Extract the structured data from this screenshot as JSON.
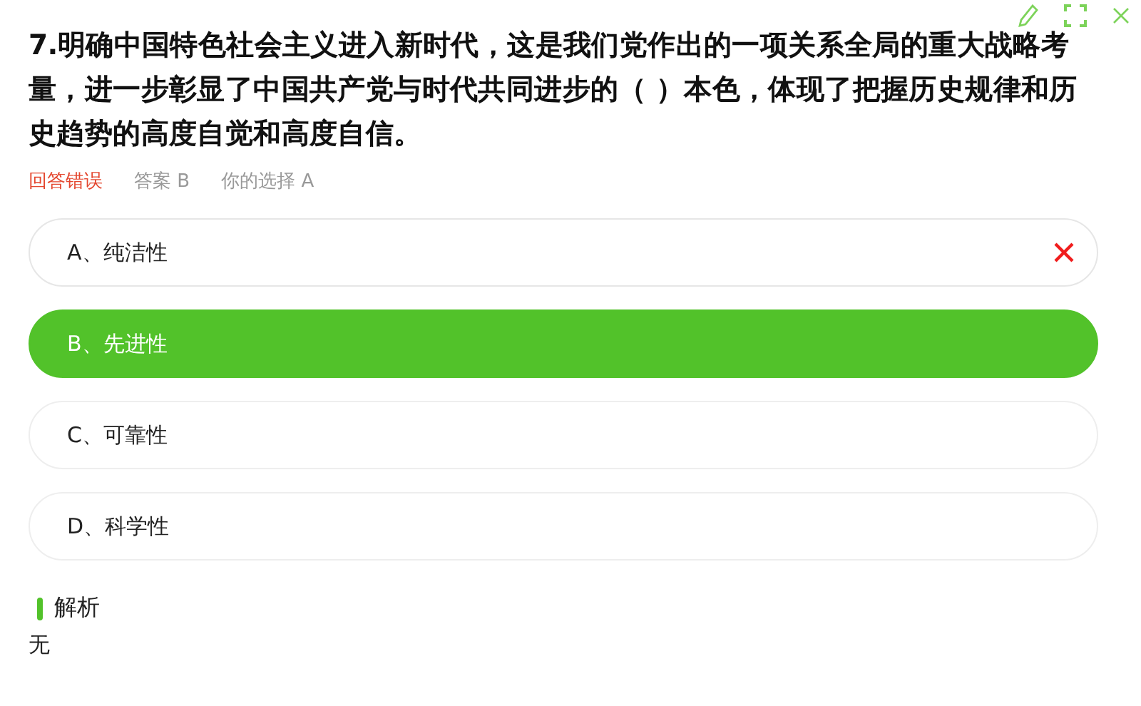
{
  "question": "7.明确中国特色社会主义进入新时代，这是我们党作出的一项关系全局的重大战略考量，进一步彰显了中国共产党与时代共同进步的（ ）本色，体现了把握历史规律和历史趋势的高度自觉和高度自信。",
  "result": {
    "verdict": "回答错误",
    "correct": false,
    "answer": "答案 B",
    "choice": "你的选择 A"
  },
  "options": [
    {
      "label": "A、纯洁性",
      "selected": true,
      "correct": false
    },
    {
      "label": "B、先进性",
      "selected": false,
      "correct": true
    },
    {
      "label": "C、可靠性",
      "selected": false,
      "correct": false
    },
    {
      "label": "D、科学性",
      "selected": false,
      "correct": false
    }
  ],
  "analysis": {
    "heading": "解析",
    "text": "无"
  }
}
